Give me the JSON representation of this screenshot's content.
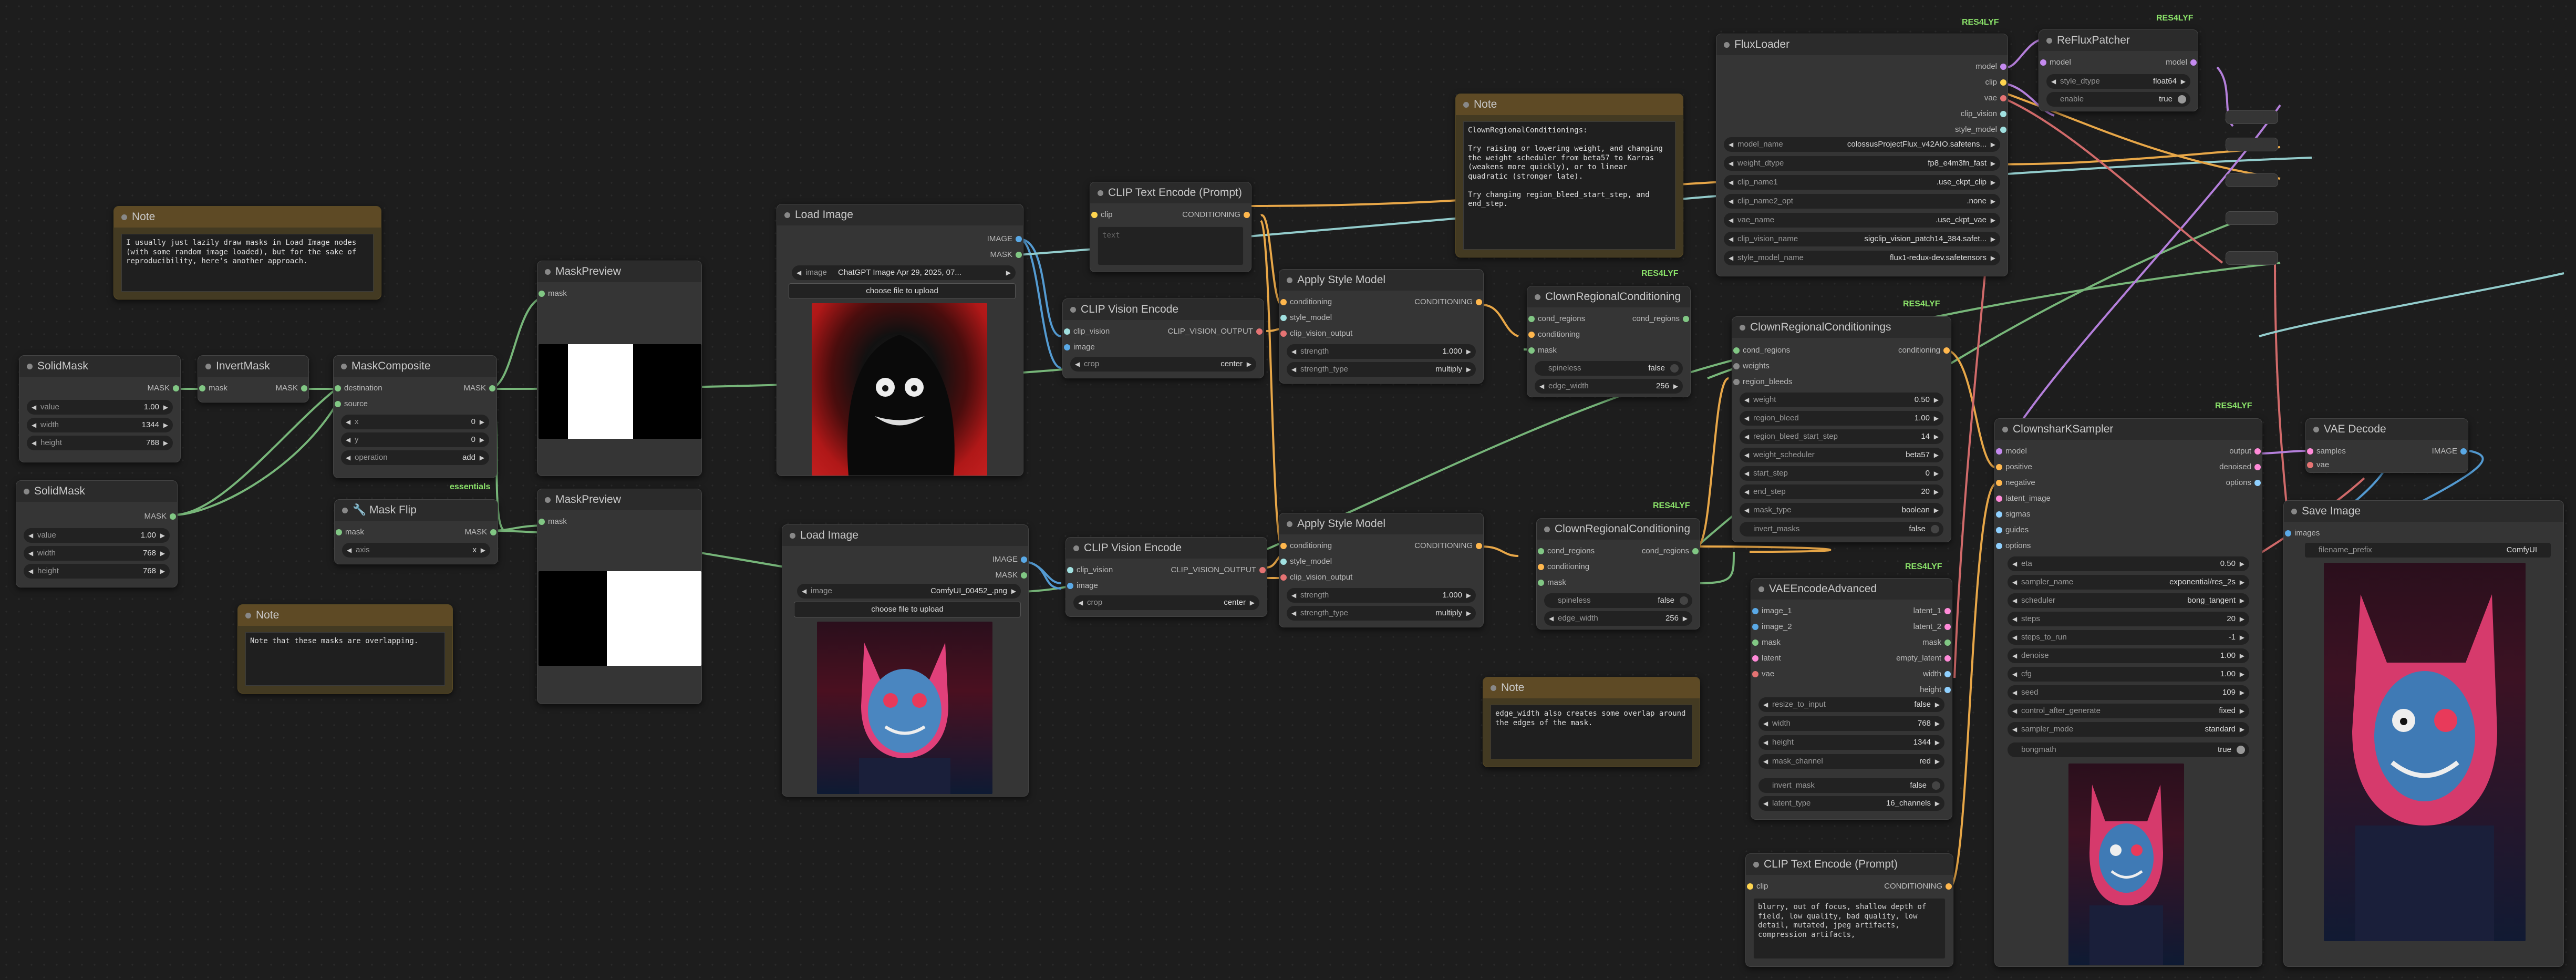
{
  "tags": {
    "essentials": "essentials",
    "res4lyf": "RES4LYF"
  },
  "notes": {
    "n1": {
      "title": "Note",
      "text": "I usually just lazily draw masks in Load Image nodes (with some random image loaded), but for the sake of reproducibility, here's another approach."
    },
    "n2": {
      "title": "Note",
      "text": "Note that these masks are overlapping."
    },
    "n3": {
      "title": "Note",
      "text": "ClownRegionalConditionings:\n\nTry raising or lowering weight, and changing the weight scheduler from beta57 to Karras (weakens more quickly), or to linear quadratic (stronger late).\n\nTry changing region_bleed_start_step, and end_step."
    },
    "n4": {
      "title": "Note",
      "text": "edge_width also creates some overlap around the edges of the mask."
    }
  },
  "solidmask1": {
    "title": "SolidMask",
    "out": "MASK",
    "value_l": "value",
    "value": "1.00",
    "width_l": "width",
    "width": "1344",
    "height_l": "height",
    "height": "768"
  },
  "solidmask2": {
    "title": "SolidMask",
    "out": "MASK",
    "value_l": "value",
    "value": "1.00",
    "width_l": "width",
    "width": "768",
    "height_l": "height",
    "height": "768"
  },
  "invertmask": {
    "title": "InvertMask",
    "in": "mask",
    "out": "MASK"
  },
  "maskcomposite": {
    "title": "MaskComposite",
    "in1": "destination",
    "in2": "source",
    "out": "MASK",
    "x_l": "x",
    "x": "0",
    "y_l": "y",
    "y": "0",
    "op_l": "operation",
    "op": "add"
  },
  "maskflip": {
    "title": "🔧 Mask Flip",
    "in": "mask",
    "out": "MASK",
    "axis_l": "axis",
    "axis": "x"
  },
  "maskpreview1": {
    "title": "MaskPreview",
    "in": "mask"
  },
  "maskpreview2": {
    "title": "MaskPreview",
    "in": "mask"
  },
  "loadimage1": {
    "title": "Load Image",
    "out1": "IMAGE",
    "out2": "MASK",
    "image_l": "image",
    "image": "ChatGPT Image Apr 29, 2025, 07...",
    "upload": "choose file to upload"
  },
  "loadimage2": {
    "title": "Load Image",
    "out1": "IMAGE",
    "out2": "MASK",
    "image_l": "image",
    "image": "ComfyUI_00452_.png",
    "upload": "choose file to upload"
  },
  "cliptext1": {
    "title": "CLIP Text Encode (Prompt)",
    "in": "clip",
    "out": "CONDITIONING",
    "text": "text"
  },
  "cliptext2": {
    "title": "CLIP Text Encode (Prompt)",
    "in": "clip",
    "out": "CONDITIONING",
    "text": "blurry, out of focus, shallow depth of field, low quality, bad quality, low detail, mutated, jpeg artifacts, compression artifacts,"
  },
  "clipvision1": {
    "title": "CLIP Vision Encode",
    "in1": "clip_vision",
    "in2": "image",
    "out": "CLIP_VISION_OUTPUT",
    "crop_l": "crop",
    "crop": "center"
  },
  "clipvision2": {
    "title": "CLIP Vision Encode",
    "in1": "clip_vision",
    "in2": "image",
    "out": "CLIP_VISION_OUTPUT",
    "crop_l": "crop",
    "crop": "center"
  },
  "style1": {
    "title": "Apply Style Model",
    "in1": "conditioning",
    "in2": "style_model",
    "in3": "clip_vision_output",
    "out": "CONDITIONING",
    "str_l": "strength",
    "str": "1.000",
    "st_l": "strength_type",
    "st": "multiply"
  },
  "style2": {
    "title": "Apply Style Model",
    "in1": "conditioning",
    "in2": "style_model",
    "in3": "clip_vision_output",
    "out": "CONDITIONING",
    "str_l": "strength",
    "str": "1.000",
    "st_l": "strength_type",
    "st": "multiply"
  },
  "crc1": {
    "title": "ClownRegionalConditioning",
    "in1": "cond_regions",
    "in2": "conditioning",
    "in3": "mask",
    "out": "cond_regions",
    "sp_l": "spineless",
    "sp": "false",
    "ew_l": "edge_width",
    "ew": "256"
  },
  "crc2": {
    "title": "ClownRegionalConditioning",
    "in1": "cond_regions",
    "in2": "conditioning",
    "in3": "mask",
    "out": "cond_regions",
    "sp_l": "spineless",
    "sp": "false",
    "ew_l": "edge_width",
    "ew": "256"
  },
  "crcs": {
    "title": "ClownRegionalConditionings",
    "in1": "cond_regions",
    "in2": "weights",
    "in3": "region_bleeds",
    "out": "conditioning",
    "w": [
      [
        "weight",
        "0.50"
      ],
      [
        "region_bleed",
        "1.00"
      ],
      [
        "region_bleed_start_step",
        "14"
      ],
      [
        "weight_scheduler",
        "beta57"
      ],
      [
        "start_step",
        "0"
      ],
      [
        "end_step",
        "20"
      ],
      [
        "mask_type",
        "boolean"
      ]
    ],
    "inv_l": "invert_masks",
    "inv": "false"
  },
  "fluxloader": {
    "title": "FluxLoader",
    "outs": [
      "model",
      "clip",
      "vae",
      "clip_vision",
      "style_model"
    ],
    "w": [
      [
        "model_name",
        "colossusProjectFlux_v42AIO.safetens..."
      ],
      [
        "weight_dtype",
        "fp8_e4m3fn_fast"
      ],
      [
        "clip_name1",
        ".use_ckpt_clip"
      ],
      [
        "clip_name2_opt",
        ".none"
      ],
      [
        "vae_name",
        ".use_ckpt_vae"
      ],
      [
        "clip_vision_name",
        "sigclip_vision_patch14_384.safet..."
      ],
      [
        "style_model_name",
        "flux1-redux-dev.safetensors"
      ]
    ]
  },
  "refluxpatcher": {
    "title": "ReFluxPatcher",
    "in": "model",
    "out": "model",
    "sd_l": "style_dtype",
    "sd": "float64",
    "en_l": "enable",
    "en": "true"
  },
  "vaeenc": {
    "title": "VAEEncodeAdvanced",
    "ins": [
      "image_1",
      "image_2",
      "mask",
      "latent",
      "vae"
    ],
    "outs": [
      "latent_1",
      "latent_2",
      "mask",
      "empty_latent",
      "width",
      "height"
    ],
    "w": [
      [
        "resize_to_input",
        "false"
      ],
      [
        "width",
        "768"
      ],
      [
        "height",
        "1344"
      ],
      [
        "mask_channel",
        "red"
      ]
    ],
    "inv_l": "invert_mask",
    "inv": "false",
    "lt_l": "latent_type",
    "lt": "16_channels"
  },
  "sampler": {
    "title": "ClownsharKSampler",
    "ins": [
      "model",
      "positive",
      "negative",
      "latent_image",
      "sigmas",
      "guides",
      "options"
    ],
    "outs": [
      "output",
      "denoised",
      "options"
    ],
    "w": [
      [
        "eta",
        "0.50"
      ],
      [
        "sampler_name",
        "exponential/res_2s"
      ],
      [
        "scheduler",
        "bong_tangent"
      ],
      [
        "steps",
        "20"
      ],
      [
        "steps_to_run",
        "-1"
      ],
      [
        "denoise",
        "1.00"
      ],
      [
        "cfg",
        "1.00"
      ],
      [
        "seed",
        "109"
      ],
      [
        "control_after_generate",
        "fixed"
      ],
      [
        "sampler_mode",
        "standard"
      ]
    ],
    "bm_l": "bongmath",
    "bm": "true"
  },
  "vaedecode": {
    "title": "VAE Decode",
    "in1": "samples",
    "in2": "vae",
    "out": "IMAGE"
  },
  "saveimage": {
    "title": "Save Image",
    "in": "images",
    "fp_l": "filename_prefix",
    "fp": "ComfyUI"
  }
}
